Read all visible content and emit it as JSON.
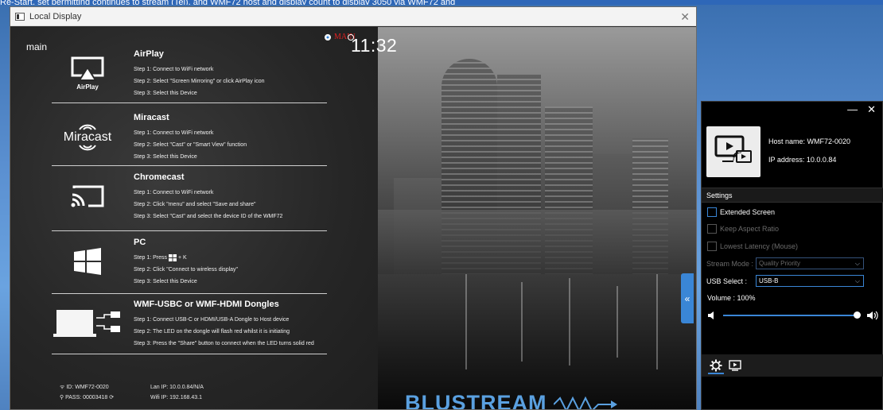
{
  "desktop_caption": "Re-Start, set permitting continues to stream (Tel), and WMF72 host and display count to display 3050 via WMF72 and",
  "window": {
    "title": "Local Display",
    "close_glyph": "✕"
  },
  "main_label": "main",
  "mode_label": "MAIN",
  "clock": "11:32",
  "sections": [
    {
      "icon": "airplay-icon",
      "icon_label": "AirPlay",
      "heading": "AirPlay",
      "steps": [
        "Step 1: Connect to WiFi network",
        "Step 2: Select  \"Screen Mirroring\" or click AirPlay icon",
        "Step 3: Select this Device"
      ]
    },
    {
      "icon": "miracast-icon",
      "icon_label": "Miracast",
      "heading": "Miracast",
      "steps": [
        "Step 1: Connect to WiFi network",
        "Step 2: Select \"Cast\" or \"Smart View\" function",
        "Step 3: Select this Device"
      ]
    },
    {
      "icon": "chromecast-icon",
      "icon_label": "",
      "heading": "Chromecast",
      "steps": [
        "Step 1: Connect to WiFi network",
        "Step 2: Click \"menu\" and select  \"Save and share\"",
        "Step 3: Select \"Cast\" and select the device ID of the WMF72"
      ]
    },
    {
      "icon": "windows-icon",
      "icon_label": "",
      "heading": "PC",
      "steps": [
        "Step 1: Press",
        "Step 2: Click \"Connect to wireless display\"",
        "Step 3: Select this Device"
      ],
      "step1_suffix": "+ K"
    },
    {
      "icon": "dongle-icon",
      "icon_label": "",
      "heading": "WMF-USBC or WMF-HDMI Dongles",
      "steps": [
        "Step 1: Connect USB-C or HDMI/USB-A Dongle to Host device",
        "Step 2: The LED on the dongle will flash red whilst it is initiating",
        "Step 3: Press the \"Share\" button to connect when the LED turns solid red"
      ]
    }
  ],
  "footer": {
    "id": "ID: WMF72-0020",
    "pass": "PASS: 00003418",
    "lan_ip": "Lan IP: 10.0.0.84/N/A",
    "wifi_ip": "Wifi IP: 192.168.43.1"
  },
  "brand": "BLUSTREAM",
  "collapse_glyph": "«",
  "side_panel": {
    "minimize_glyph": "—",
    "close_glyph": "✕",
    "host_name": "Host name: WMF72-0020",
    "ip_address": "IP address: 10.0.0.84",
    "settings_label": "Settings",
    "extended_screen": "Extended Screen",
    "keep_aspect_ratio": "Keep Aspect Ratio",
    "lowest_latency": "Lowest Latency  (Mouse)",
    "stream_mode_label": "Stream Mode :",
    "stream_mode_value": "Quality Priority",
    "usb_select_label": "USB Select :",
    "usb_select_value": "USB-B",
    "volume_label": "Volume  : 100%",
    "volume_level": 1.0,
    "accent": "#3a86d6"
  }
}
